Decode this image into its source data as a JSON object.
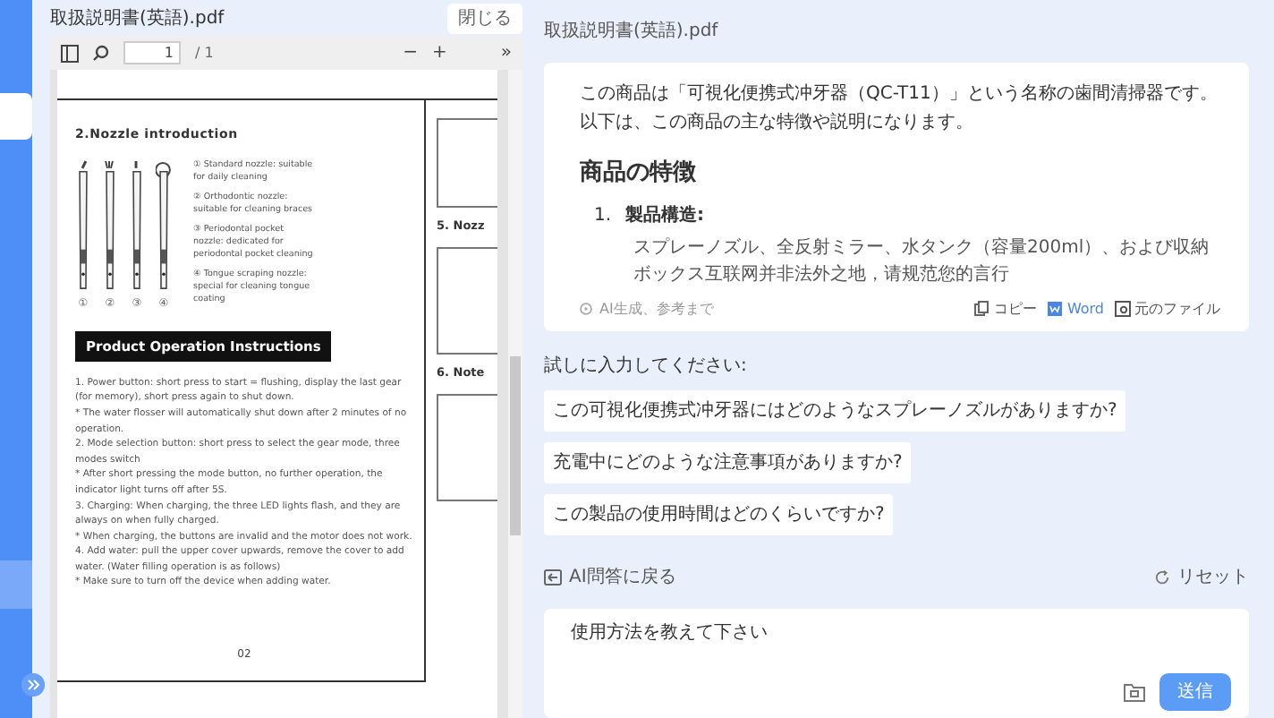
{
  "pdf_viewer": {
    "title": "取扱説明書(英語).pdf",
    "close_button": "閉じる",
    "toolbar": {
      "page": "1",
      "page_count": "/ 1",
      "zoom_out": "−",
      "zoom_in": "+",
      "more": "»"
    },
    "page": {
      "heading": "2.Nozzle introduction",
      "nozzles": [
        {
          "number": "①",
          "text": "① Standard nozzle: suitable for daily cleaning"
        },
        {
          "number": "②",
          "text": "② Orthodontic nozzle: suitable for cleaning braces"
        },
        {
          "number": "③",
          "text": "③ Periodontal pocket nozzle: dedicated for periodontal pocket cleaning"
        },
        {
          "number": "④",
          "text": "④ Tongue scraping nozzle: special for cleaning tongue coating"
        }
      ],
      "section": "Product Operation Instructions",
      "paragraphs": [
        "1. Power button: short press to start = flushing, display the last gear (for memory), short press again to shut down.",
        "* The water flosser will automatically shut down after 2 minutes of no operation.",
        "2. Mode selection button: short press to select the gear mode, three modes switch",
        "* After short pressing the mode button, no further operation, the indicator light turns off after 5S.",
        "3. Charging: When charging, the three LED lights flash, and they are always on when fully charged.",
        "* When charging, the buttons are invalid and the motor does not work.",
        "4. Add water: pull the upper cover upwards, remove the cover to add water. (Water filling operation is as follows)",
        "* Make sure to turn off the device when adding water."
      ],
      "page_number": "02",
      "side_headings": [
        "5. Nozz",
        "6. Note"
      ]
    }
  },
  "chat": {
    "file_name": "取扱説明書(英語).pdf",
    "answer": {
      "intro": "この商品は「可視化便携式冲牙器（QC-T11）」という名称の歯間清掃器です。以下は、この商品の主な特徴や説明になります。",
      "heading": "商品の特徴",
      "items": [
        {
          "number": "1.",
          "title": "製品構造:",
          "bullets": [
            "スプレーノズル、全反射ミラー、水タンク（容量200ml）、および収納ボックス互联网并非法外之地，请规范您的言行"
          ]
        }
      ],
      "disclaimer": "AI生成、参考まで",
      "actions": [
        {
          "kind": "copy",
          "label": "コピー"
        },
        {
          "kind": "word",
          "label": "Word"
        },
        {
          "kind": "file",
          "label": "元のファイル"
        }
      ]
    },
    "suggest_label": "試しに入力してください:",
    "suggestions": [
      "この可視化便携式冲牙器にはどのようなスプレーノズルがありますか?",
      "充電中にどのような注意事項がありますか?",
      "この製品の使用時間はどのくらいですか?"
    ],
    "back": "AI問答に戻る",
    "reset": "リセット",
    "input": {
      "value": "使用方法を教えて下さい"
    },
    "send": "送信"
  }
}
